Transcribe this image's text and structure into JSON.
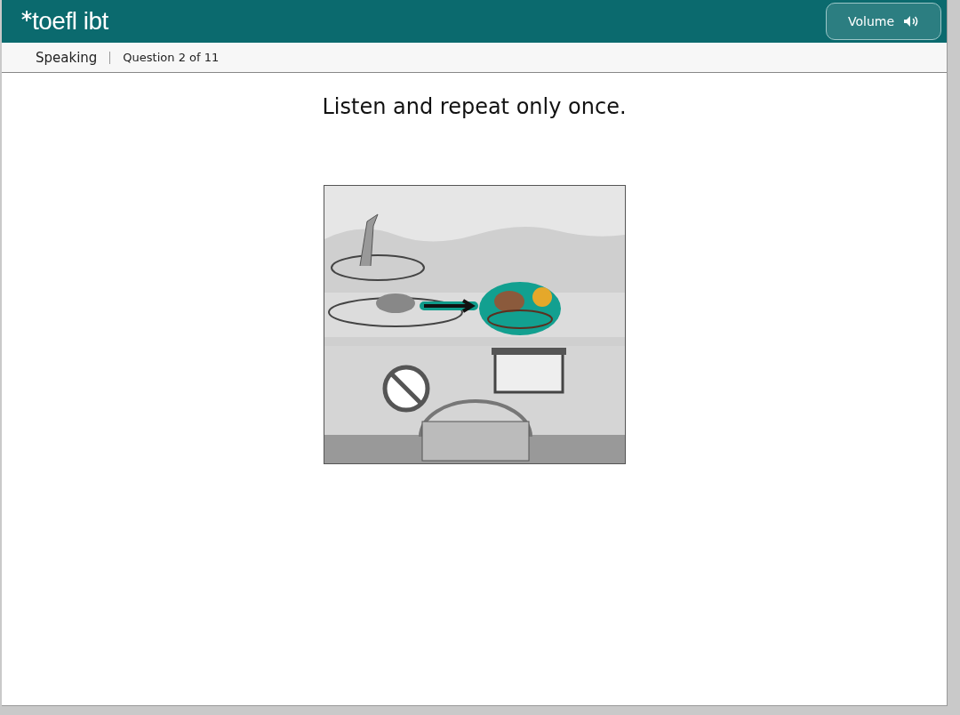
{
  "header": {
    "logo": "toefl ibt",
    "volume_button": "Volume"
  },
  "subheader": {
    "section": "Speaking",
    "question": "Question 2 of 11"
  },
  "prompt": "Listen and repeat only once."
}
